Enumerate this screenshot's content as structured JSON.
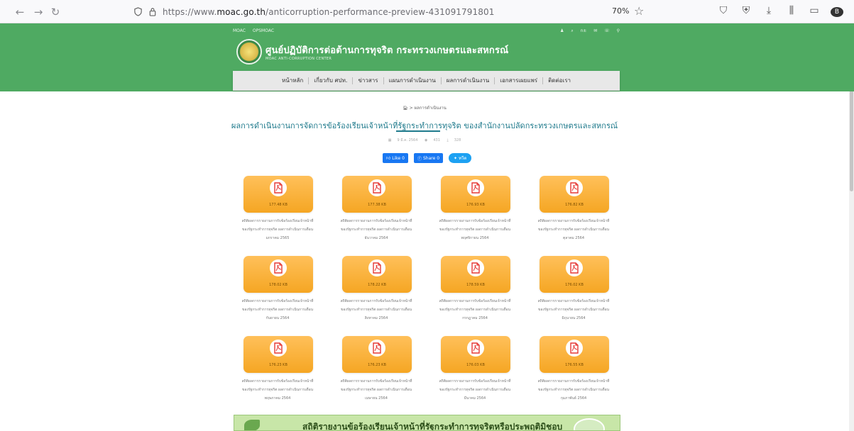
{
  "browser": {
    "url_prefix": "https://www.",
    "url_domain": "moac.go.th",
    "url_path": "/anticorruption-performance-preview-431091791801",
    "zoom": "70%"
  },
  "header": {
    "top_links": [
      "MOAC",
      "OPSMOAC"
    ],
    "site_title": "ศูนย์ปฏิบัติการต่อต้านการทุจริต กระทรวงเกษตรและสหกรณ์",
    "site_subtitle": "MOAC ANTI-CORRUPTION CENTER"
  },
  "menu": {
    "items": [
      "หน้าหลัก",
      "เกี่ยวกับ ศปท.",
      "ข่าวสาร",
      "แผนการดำเนินงาน",
      "ผลการดำเนินงาน",
      "เอกสารเผยแพร่",
      "ติดต่อเรา"
    ]
  },
  "breadcrumb": {
    "current": "ผลการดำเนินงาน"
  },
  "page": {
    "title": "ผลการดำเนินงานการจัดการข้อร้องเรียนเจ้าหน้าที่รัฐกระทำการทุจริต ของสำนักงานปลัดกระทรวงเกษตรและสหกรณ์",
    "date": "9 มี.ค. 2564",
    "views": "431",
    "downloads": "328"
  },
  "social": {
    "like": "Like 0",
    "share": "Share 0",
    "tweet": "ทวีต"
  },
  "documents": [
    {
      "size": "177.48 KB",
      "line1": "สถิติผลการรายงานการรับข้อร้องเรียนเจ้าหน้าที่",
      "line2": "ของรัฐกระทำการทุจริต ผลการดำเนินการเดือน",
      "line3": "มกราคม 2565"
    },
    {
      "size": "177.38 KB",
      "line1": "สถิติผลการรายงานการรับข้อร้องเรียนเจ้าหน้าที่",
      "line2": "ของรัฐกระทำการทุจริต ผลการดำเนินการเดือน",
      "line3": "ธันวาคม 2564"
    },
    {
      "size": "176.93 KB",
      "line1": "สถิติผลการรายงานการรับข้อร้องเรียนเจ้าหน้าที่",
      "line2": "ของรัฐกระทำการทุจริต ผลการดำเนินการเดือน",
      "line3": "พฤศจิกายน 2564"
    },
    {
      "size": "176.82 KB",
      "line1": "สถิติผลการรายงานการรับข้อร้องเรียนเจ้าหน้าที่",
      "line2": "ของรัฐกระทำการทุจริต ผลการดำเนินการเดือน",
      "line3": "ตุลาคม 2564"
    },
    {
      "size": "178.02 KB",
      "line1": "สถิติผลการรายงานการรับข้อร้องเรียนเจ้าหน้าที่",
      "line2": "ของรัฐกระทำการทุจริต ผลการดำเนินการเดือน",
      "line3": "กันยายน 2564"
    },
    {
      "size": "178.22 KB",
      "line1": "สถิติผลการรายงานการรับข้อร้องเรียนเจ้าหน้าที่",
      "line2": "ของรัฐกระทำการทุจริต ผลการดำเนินการเดือน",
      "line3": "สิงหาคม 2564"
    },
    {
      "size": "178.59 KB",
      "line1": "สถิติผลการรายงานการรับข้อร้องเรียนเจ้าหน้าที่",
      "line2": "ของรัฐกระทำการทุจริต ผลการดำเนินการเดือน",
      "line3": "กรกฎาคม 2564"
    },
    {
      "size": "176.02 KB",
      "line1": "สถิติผลการรายงานการรับข้อร้องเรียนเจ้าหน้าที่",
      "line2": "ของรัฐกระทำการทุจริต ผลการดำเนินการเดือน",
      "line3": "มิถุนายน 2564"
    },
    {
      "size": "176.23 KB",
      "line1": "สถิติผลการรายงานการรับข้อร้องเรียนเจ้าหน้าที่",
      "line2": "ของรัฐกระทำการทุจริต ผลการดำเนินการเดือน",
      "line3": "พฤษภาคม 2564"
    },
    {
      "size": "176.23 KB",
      "line1": "สถิติผลการรายงานการรับข้อร้องเรียนเจ้าหน้าที่",
      "line2": "ของรัฐกระทำการทุจริต ผลการดำเนินการเดือน",
      "line3": "เมษายน 2564"
    },
    {
      "size": "176.03 KB",
      "line1": "สถิติผลการรายงานการรับข้อร้องเรียนเจ้าหน้าที่",
      "line2": "ของรัฐกระทำการทุจริต ผลการดำเนินการเดือน",
      "line3": "มีนาคม 2564"
    },
    {
      "size": "176.55 KB",
      "line1": "สถิติผลการรายงานการรับข้อร้องเรียนเจ้าหน้าที่",
      "line2": "ของรัฐกระทำการทุจริต ผลการดำเนินการเดือน",
      "line3": "กุมภาพันธ์ 2564"
    }
  ],
  "banner": {
    "text": "สถิติรายงานข้อร้องเรียนเจ้าหน้าที่รัฐกระทำการทุจริตหรือประพฤติมิชอบ"
  },
  "colors": {
    "header_green": "#4faa62",
    "title_teal": "#1f7a8c",
    "card_orange": "#f5a623",
    "pdf_red": "#e53935"
  }
}
